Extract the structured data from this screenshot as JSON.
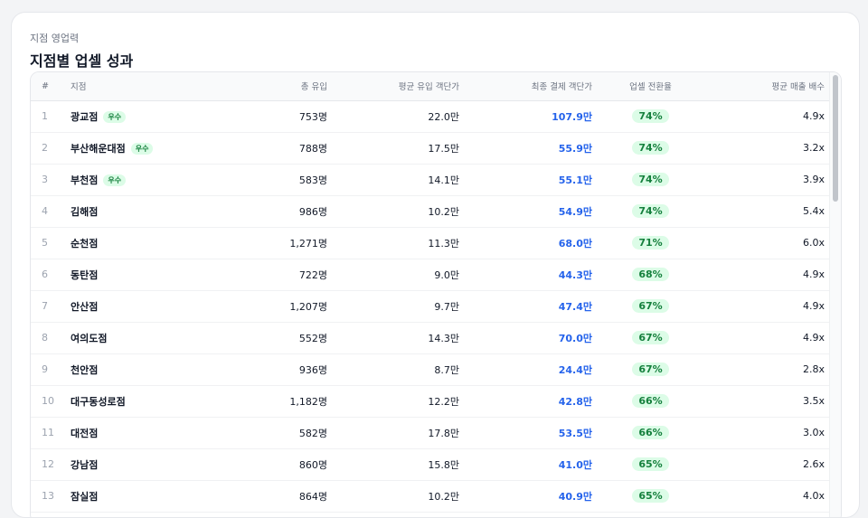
{
  "header": {
    "eyebrow": "지점 영업력",
    "title": "지점별 업셀 성과"
  },
  "table": {
    "columns": {
      "idx": "#",
      "name": "지점",
      "inflow": "총 유입",
      "avg_inflow_price": "평균 유입 객단가",
      "final_price": "최종 결제 객단가",
      "conversion": "업셀 전환율",
      "multiplier": "평균 매출 배수"
    },
    "rows": [
      {
        "idx": "1",
        "name": "광교점",
        "badge": "우수",
        "inflow": "753명",
        "avg": "22.0만",
        "final": "107.9만",
        "conv": "74%",
        "mult": "4.9x"
      },
      {
        "idx": "2",
        "name": "부산해운대점",
        "badge": "우수",
        "inflow": "788명",
        "avg": "17.5만",
        "final": "55.9만",
        "conv": "74%",
        "mult": "3.2x"
      },
      {
        "idx": "3",
        "name": "부천점",
        "badge": "우수",
        "inflow": "583명",
        "avg": "14.1만",
        "final": "55.1만",
        "conv": "74%",
        "mult": "3.9x"
      },
      {
        "idx": "4",
        "name": "김해점",
        "badge": "",
        "inflow": "986명",
        "avg": "10.2만",
        "final": "54.9만",
        "conv": "74%",
        "mult": "5.4x"
      },
      {
        "idx": "5",
        "name": "순천점",
        "badge": "",
        "inflow": "1,271명",
        "avg": "11.3만",
        "final": "68.0만",
        "conv": "71%",
        "mult": "6.0x"
      },
      {
        "idx": "6",
        "name": "동탄점",
        "badge": "",
        "inflow": "722명",
        "avg": "9.0만",
        "final": "44.3만",
        "conv": "68%",
        "mult": "4.9x"
      },
      {
        "idx": "7",
        "name": "안산점",
        "badge": "",
        "inflow": "1,207명",
        "avg": "9.7만",
        "final": "47.4만",
        "conv": "67%",
        "mult": "4.9x"
      },
      {
        "idx": "8",
        "name": "여의도점",
        "badge": "",
        "inflow": "552명",
        "avg": "14.3만",
        "final": "70.0만",
        "conv": "67%",
        "mult": "4.9x"
      },
      {
        "idx": "9",
        "name": "천안점",
        "badge": "",
        "inflow": "936명",
        "avg": "8.7만",
        "final": "24.4만",
        "conv": "67%",
        "mult": "2.8x"
      },
      {
        "idx": "10",
        "name": "대구동성로점",
        "badge": "",
        "inflow": "1,182명",
        "avg": "12.2만",
        "final": "42.8만",
        "conv": "66%",
        "mult": "3.5x"
      },
      {
        "idx": "11",
        "name": "대전점",
        "badge": "",
        "inflow": "582명",
        "avg": "17.8만",
        "final": "53.5만",
        "conv": "66%",
        "mult": "3.0x"
      },
      {
        "idx": "12",
        "name": "강남점",
        "badge": "",
        "inflow": "860명",
        "avg": "15.8만",
        "final": "41.0만",
        "conv": "65%",
        "mult": "2.6x"
      },
      {
        "idx": "13",
        "name": "잠실점",
        "badge": "",
        "inflow": "864명",
        "avg": "10.2만",
        "final": "40.9만",
        "conv": "65%",
        "mult": "4.0x"
      }
    ]
  },
  "colors": {
    "accent_blue": "#2563eb",
    "success_green": "#15803d",
    "success_bg": "#dcfce7"
  }
}
